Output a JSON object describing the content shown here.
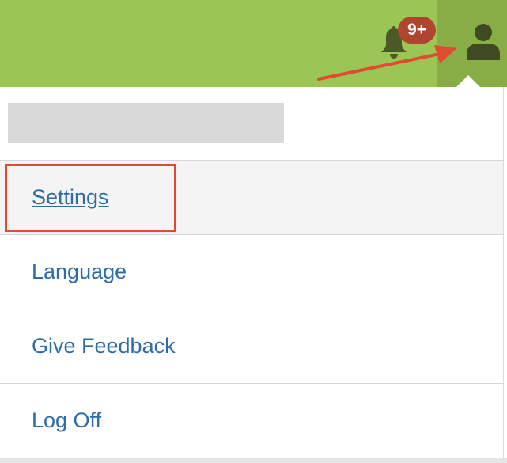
{
  "header": {
    "background_color": "#9bc554",
    "active_area_color": "#88ad46",
    "notifications": {
      "icon": "bell-icon",
      "badge_text": "9+",
      "badge_color": "#b0452f"
    },
    "user_menu": {
      "icon": "user-icon"
    }
  },
  "dropdown": {
    "user_name": "",
    "menu_items": [
      {
        "label": "Settings",
        "state": "hovered",
        "underlined": true
      },
      {
        "label": "Language"
      },
      {
        "label": "Give Feedback"
      },
      {
        "label": "Log Off"
      }
    ],
    "link_color": "#2e6ca6"
  },
  "annotations": {
    "highlight_color": "#e24a32",
    "highlight_target": "Settings",
    "arrow_target": "user-icon"
  }
}
